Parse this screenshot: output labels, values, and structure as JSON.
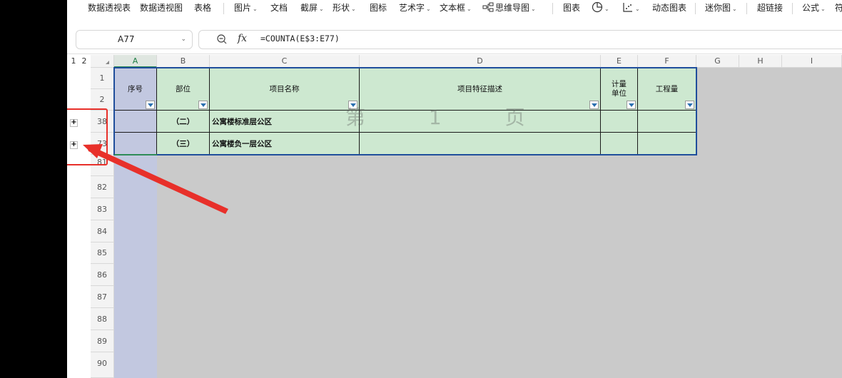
{
  "ribbon": {
    "items": [
      {
        "label": "数据透视表",
        "chev": false
      },
      {
        "label": "数据透视图",
        "chev": false
      },
      {
        "label": "表格",
        "chev": false
      },
      {
        "label": "图片",
        "chev": true
      },
      {
        "label": "文档",
        "chev": false
      },
      {
        "label": "截屏",
        "chev": true
      },
      {
        "label": "形状",
        "chev": true
      },
      {
        "label": "图标",
        "chev": false
      },
      {
        "label": "艺术字",
        "chev": true
      },
      {
        "label": "文本框",
        "chev": true
      },
      {
        "label": "思维导图",
        "chev": true
      },
      {
        "label": "图表",
        "chev": false
      },
      {
        "label": "动态图表",
        "chev": false
      },
      {
        "label": "迷你图",
        "chev": true
      },
      {
        "label": "超链接",
        "chev": false
      },
      {
        "label": "公式",
        "chev": true
      },
      {
        "label": "符",
        "chev": false
      }
    ]
  },
  "formula_bar": {
    "name_box": "A77",
    "formula": "=COUNTA(E$3:E77)",
    "fx": "fx"
  },
  "outline_levels": [
    "1",
    "2"
  ],
  "columns": [
    "A",
    "B",
    "C",
    "D",
    "E",
    "F",
    "G",
    "H",
    "I"
  ],
  "rows": [
    "1",
    "2",
    "38",
    "73",
    "81",
    "82",
    "83",
    "84",
    "85",
    "86",
    "87",
    "88",
    "89",
    "90"
  ],
  "table": {
    "headers": {
      "seq": "序号",
      "part": "部位",
      "item_name": "项目名称",
      "feature": "项目特征描述",
      "unit": "计量\n单位",
      "qty": "工程量"
    },
    "row38": {
      "part": "（二）",
      "name": "公寓楼标准层公区"
    },
    "row73": {
      "part": "（三）",
      "name": "公寓楼负一层公区"
    }
  },
  "watermark": "第 1 页",
  "accent": {
    "red": "#e8302a",
    "table_border": "#1f4e9c",
    "green_fill": "#cde8d0"
  }
}
